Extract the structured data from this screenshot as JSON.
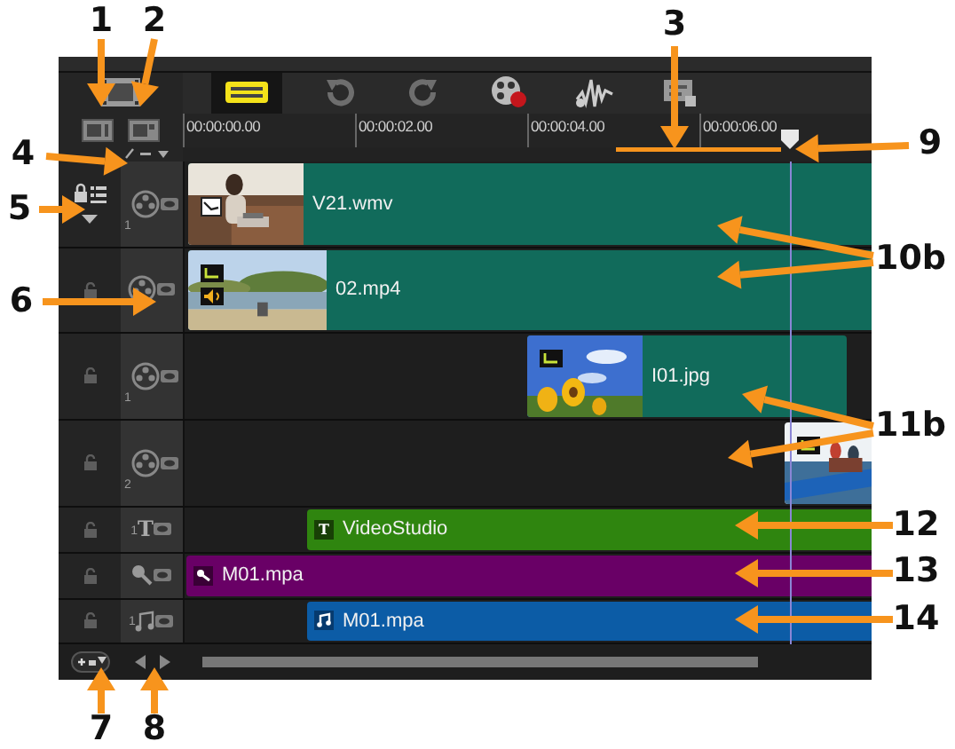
{
  "callouts": [
    {
      "label": "1"
    },
    {
      "label": "2"
    },
    {
      "label": "3"
    },
    {
      "label": "4"
    },
    {
      "label": "5"
    },
    {
      "label": "6"
    },
    {
      "label": "7"
    },
    {
      "label": "8"
    },
    {
      "label": "9"
    },
    {
      "label": "10b"
    },
    {
      "label": "11b"
    },
    {
      "label": "12"
    },
    {
      "label": "13"
    },
    {
      "label": "14"
    }
  ],
  "toolbar": {
    "buttons": [
      {
        "kind": "timeline",
        "selected": true
      },
      {
        "kind": "undo",
        "selected": false
      },
      {
        "kind": "redo",
        "selected": false
      },
      {
        "kind": "record",
        "selected": false
      },
      {
        "kind": "audio",
        "selected": false
      },
      {
        "kind": "subtitle",
        "selected": false
      }
    ]
  },
  "ruler": {
    "timecodes": [
      "00:00:00.00",
      "00:00:02.00",
      "00:00:04.00",
      "00:00:06.00"
    ]
  },
  "tracks": [
    {
      "kind": "video",
      "number": "1",
      "clip": {
        "kind": "video",
        "name": "V21.wmv",
        "color": "#116b5b"
      }
    },
    {
      "kind": "video",
      "clip": {
        "kind": "video",
        "name": "02.mp4",
        "color": "#116b5b"
      }
    },
    {
      "kind": "overlay",
      "number": "1",
      "clip": {
        "name": "I01.jpg",
        "color": "#116b5b"
      }
    },
    {
      "kind": "overlay",
      "number": "2"
    },
    {
      "kind": "title",
      "icon": "T",
      "number": "1",
      "clip": {
        "kind": "title",
        "badge": "T",
        "name": "VideoStudio",
        "color": "#2f850f"
      }
    },
    {
      "kind": "voice",
      "clip": {
        "kind": "voice",
        "name": "M01.mpa",
        "color": "#690066"
      }
    },
    {
      "kind": "music",
      "number": "1",
      "clip": {
        "kind": "music",
        "name": "M01.mpa",
        "color": "#0c5ca6"
      }
    }
  ]
}
